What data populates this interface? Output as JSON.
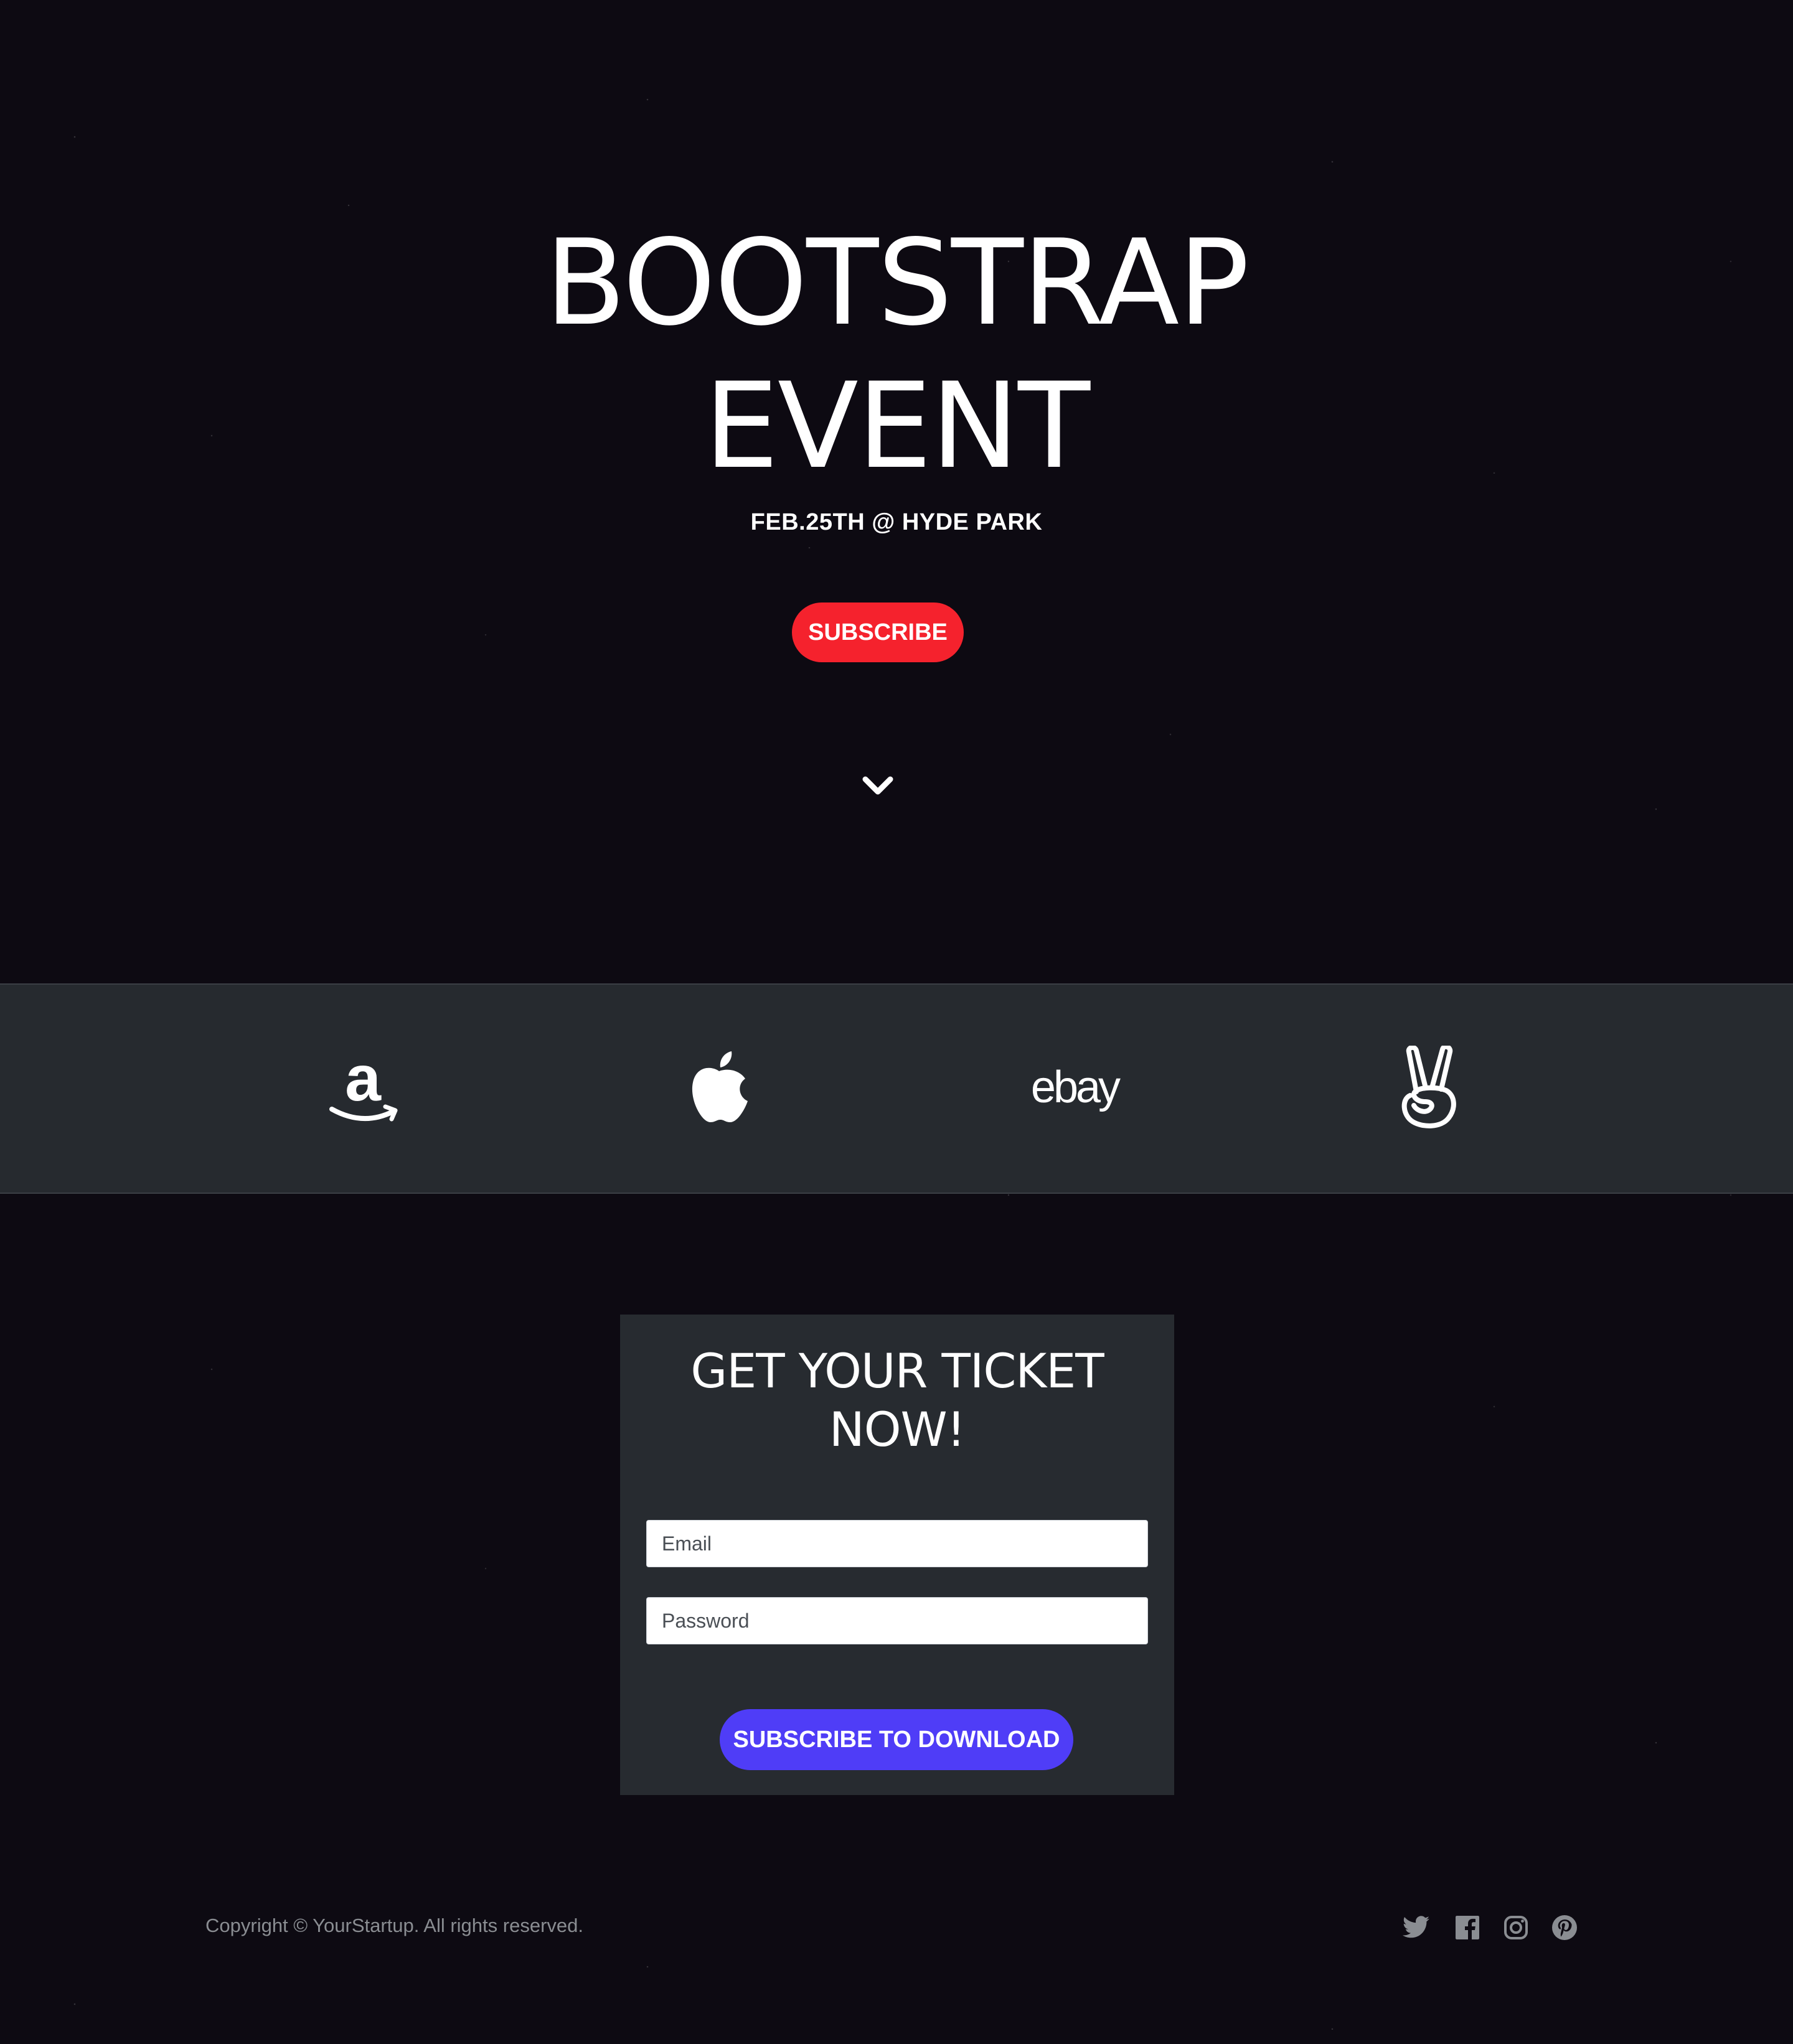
{
  "hero": {
    "title_line1": "BOOTSTRAP",
    "title_line2": "EVENT",
    "subtitle": "FEB.25TH @ HYDE PARK",
    "subscribe_label": "SUBSCRIBE",
    "scroll_icon": "chevron-down-icon"
  },
  "logos": [
    {
      "name": "amazon-logo",
      "icon": "amazon-icon"
    },
    {
      "name": "apple-logo",
      "icon": "apple-icon"
    },
    {
      "name": "ebay-logo",
      "icon": "ebay-icon",
      "text": "ebay"
    },
    {
      "name": "angellist-logo",
      "icon": "angellist-icon"
    }
  ],
  "ticket": {
    "title_line1": "GET YOUR TICKET",
    "title_line2": "NOW!",
    "email_placeholder": "Email",
    "email_value": "",
    "password_placeholder": "Password",
    "password_value": "",
    "button_label": "SUBSCRIBE TO DOWNLOAD"
  },
  "footer": {
    "copyright": "Copyright © YourStartup. All rights reserved.",
    "social": [
      "twitter-icon",
      "facebook-icon",
      "instagram-icon",
      "pinterest-icon"
    ]
  },
  "colors": {
    "background": "#0d0a12",
    "panel": "#272b30",
    "subscribe_red": "#f5222d",
    "download_purple": "#4f3df7",
    "footer_text": "#8a8d92"
  }
}
